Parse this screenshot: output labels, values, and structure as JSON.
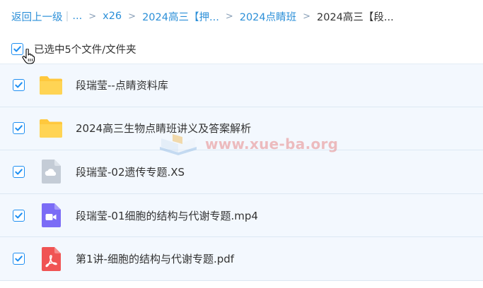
{
  "breadcrumb": {
    "back": "返回上一级",
    "ellipsis": "...",
    "separator": ">",
    "items": [
      "x26",
      "2024高三【押...",
      "2024点睛班"
    ],
    "current": "2024高三【段..."
  },
  "selection": {
    "summary": "已选中5个文件/文件夹",
    "checked": true
  },
  "files": [
    {
      "name": "段瑞莹--点睛资料库",
      "type": "folder",
      "icon": "folder-icon",
      "checked": true
    },
    {
      "name": "2024高三生物点睛班讲义及答案解析",
      "type": "folder",
      "icon": "folder-icon",
      "checked": true
    },
    {
      "name": "段瑞莹-02遗传专题.XS",
      "type": "unknown",
      "icon": "cloud-file-icon",
      "checked": true
    },
    {
      "name": "段瑞莹-01细胞的结构与代谢专题.mp4",
      "type": "video",
      "icon": "video-file-icon",
      "checked": true
    },
    {
      "name": "第1讲-细胞的结构与代谢专题.pdf",
      "type": "pdf",
      "icon": "pdf-file-icon",
      "checked": true
    }
  ],
  "watermark": {
    "text": "www.xue-ba.org"
  },
  "colors": {
    "link": "#2b8fd8",
    "checkbox": "#1f8ff2",
    "row_bg": "#f3f8fe",
    "folder": "#ffc83d",
    "video": "#7b6cf6",
    "pdf": "#f05454",
    "cloud": "#c4ccd6"
  }
}
